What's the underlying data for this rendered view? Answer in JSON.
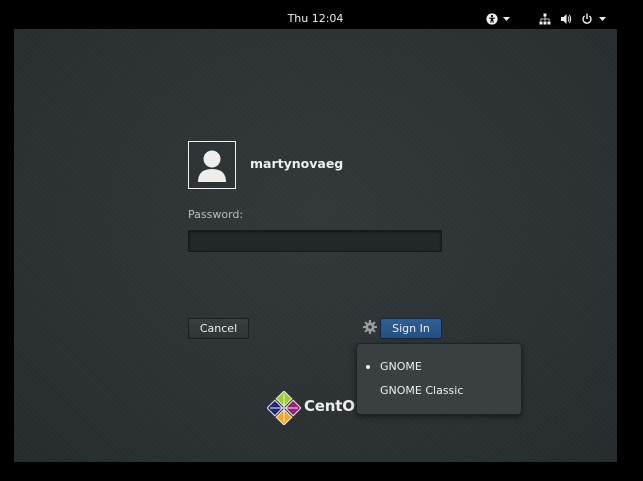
{
  "topbar": {
    "clock": "Thu 12:04",
    "icons": [
      "accessibility-icon",
      "network-icon",
      "volume-icon",
      "power-icon"
    ]
  },
  "login": {
    "username": "martynovaeg",
    "password_label": "Password:",
    "password_value": "",
    "cancel_label": "Cancel",
    "signin_label": "Sign In"
  },
  "session_menu": {
    "items": [
      {
        "label": "GNOME",
        "selected": true
      },
      {
        "label": "GNOME Classic",
        "selected": false
      }
    ]
  },
  "branding": {
    "logo_text": "CentOS"
  },
  "colors": {
    "background": "#2e3436",
    "topbar": "#000000",
    "accent": "#244f80",
    "text": "#eeeeec"
  }
}
